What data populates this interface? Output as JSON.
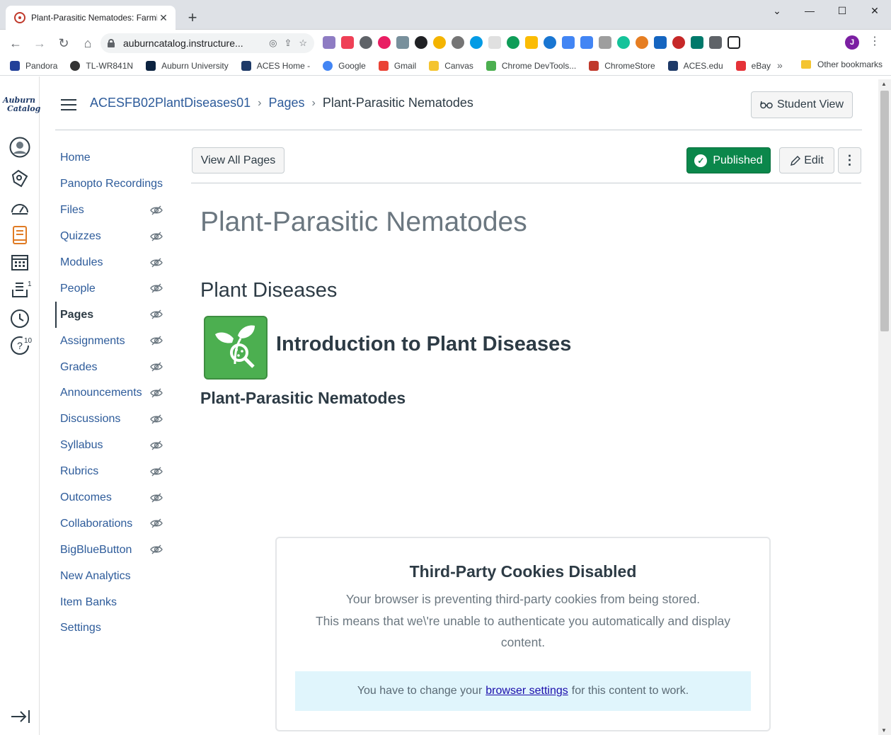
{
  "browser": {
    "tab_title": "Plant-Parasitic Nematodes: Farmi",
    "new_tab_glyph": "+",
    "url": "auburncatalog.instructure...",
    "profile_initial": "J",
    "bookmarks": [
      "Pandora",
      "TL-WR841N",
      "Auburn University",
      "ACES Home -",
      "Google",
      "Gmail",
      "Canvas",
      "Chrome DevTools...",
      "ChromeStore",
      "ACES.edu",
      "eBay"
    ],
    "bookmarks_more": "»",
    "other_bookmarks": "Other bookmarks",
    "colors": {
      "pandora": "#224099",
      "tplink": "#333333",
      "auburn": "#0c2340",
      "aces": "#1e3a68",
      "google": "#4285f4",
      "gmail": "#ea4335",
      "canvas_folder": "#f4c430",
      "devtools": "#4caf50",
      "chromestore": "#c0392b",
      "acesedu": "#1e3a68",
      "ebay": "#e53238"
    }
  },
  "logo": {
    "line1": "Auburn",
    "line2": "Catalog"
  },
  "global_nav": {
    "inbox_badge": "1",
    "help_badge": "10"
  },
  "header": {
    "breadcrumb": [
      {
        "label": "ACESFB02PlantDiseases01"
      },
      {
        "label": "Pages"
      },
      {
        "label": "Plant-Parasitic Nematodes"
      }
    ],
    "breadcrumb_sep": "›",
    "student_view_label": "Student View"
  },
  "course_nav": {
    "items": [
      {
        "label": "Home",
        "hidden": false
      },
      {
        "label": "Panopto Recordings",
        "hidden": false
      },
      {
        "label": "Files",
        "hidden": true
      },
      {
        "label": "Quizzes",
        "hidden": true
      },
      {
        "label": "Modules",
        "hidden": true
      },
      {
        "label": "People",
        "hidden": true
      },
      {
        "label": "Pages",
        "hidden": true
      },
      {
        "label": "Assignments",
        "hidden": true
      },
      {
        "label": "Grades",
        "hidden": true
      },
      {
        "label": "Announcements",
        "hidden": true
      },
      {
        "label": "Discussions",
        "hidden": true
      },
      {
        "label": "Syllabus",
        "hidden": true
      },
      {
        "label": "Rubrics",
        "hidden": true
      },
      {
        "label": "Outcomes",
        "hidden": true
      },
      {
        "label": "Collaborations",
        "hidden": true
      },
      {
        "label": "BigBlueButton",
        "hidden": true
      },
      {
        "label": "New Analytics",
        "hidden": false
      },
      {
        "label": "Item Banks",
        "hidden": false
      },
      {
        "label": "Settings",
        "hidden": false
      }
    ],
    "active_label": "Pages"
  },
  "toolbar": {
    "view_all_label": "View All Pages",
    "published_label": "Published",
    "edit_label": "Edit",
    "more_glyph": "⋮"
  },
  "page": {
    "title": "Plant-Parasitic Nematodes",
    "section_heading": "Plant Diseases",
    "intro_heading": "Introduction to Plant Diseases",
    "sub_heading": "Plant-Parasitic Nematodes"
  },
  "cookie_notice": {
    "title": "Third-Party Cookies Disabled",
    "line1": "Your browser is preventing third-party cookies from being stored.",
    "line2": "This means that we\\'re unable to authenticate you automatically and display content.",
    "alert_prefix": "You have to change your",
    "alert_link": "browser settings",
    "alert_suffix": "for this content to work."
  },
  "colors": {
    "brand_link": "#2d5b9a",
    "published_green": "#0b874b",
    "text": "#2d3b45",
    "muted": "#6b7780",
    "alert_bg": "#e0f5fc",
    "tile_green": "#4caf50"
  }
}
